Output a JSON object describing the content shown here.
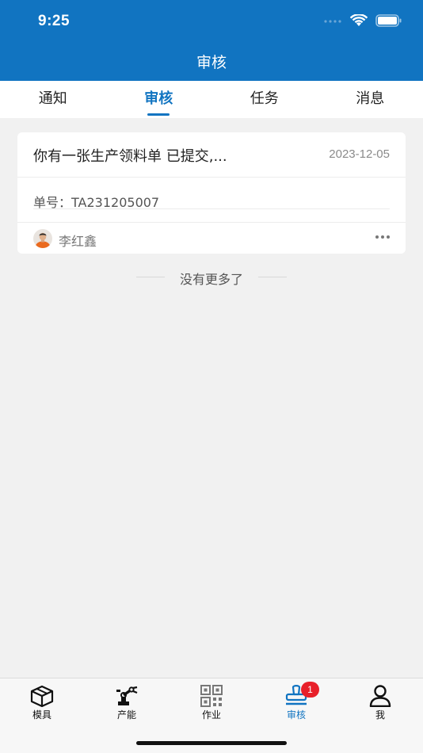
{
  "status_bar": {
    "time": "9:25"
  },
  "nav": {
    "title": "审核"
  },
  "tabs": [
    {
      "label": "通知",
      "active": false
    },
    {
      "label": "审核",
      "active": true
    },
    {
      "label": "任务",
      "active": false
    },
    {
      "label": "消息",
      "active": false
    }
  ],
  "card": {
    "title": "你有一张生产领料单 已提交,...",
    "date": "2023-12-05",
    "order_label": "单号：",
    "order_number": "TA231205007",
    "user": "李红鑫"
  },
  "list_end_text": "没有更多了",
  "tabbar": {
    "items": [
      {
        "label": "模具",
        "icon": "box-icon"
      },
      {
        "label": "产能",
        "icon": "robot-arm-icon"
      },
      {
        "label": "作业",
        "icon": "qr-code-icon"
      },
      {
        "label": "审核",
        "icon": "stamp-icon",
        "active": true,
        "badge": "1"
      },
      {
        "label": "我",
        "icon": "person-icon"
      }
    ]
  },
  "colors": {
    "primary": "#1174c1",
    "badge": "#e8202a",
    "background": "#f1f1f1"
  }
}
